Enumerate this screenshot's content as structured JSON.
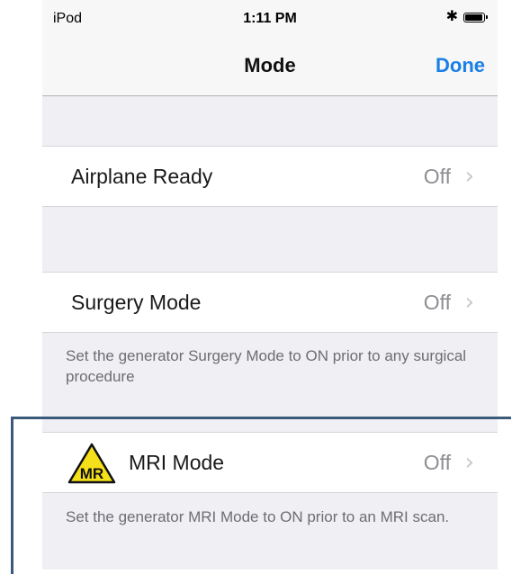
{
  "status_bar": {
    "carrier": "iPod",
    "time": "1:11 PM"
  },
  "nav": {
    "title": "Mode",
    "done_label": "Done"
  },
  "settings": [
    {
      "label": "Airplane Ready",
      "value": "Off"
    },
    {
      "label": "Surgery Mode",
      "value": "Off",
      "footer": "Set the generator Surgery Mode to ON prior to any surgical procedure"
    },
    {
      "label": "MRI Mode",
      "value": "Off",
      "footer": "Set the generator MRI Mode to ON prior to an MRI scan.",
      "badge": "MR"
    }
  ],
  "colors": {
    "accent": "#1a7fe6",
    "mr_badge": "#f5e01a",
    "highlight": "#3b5a7a"
  }
}
